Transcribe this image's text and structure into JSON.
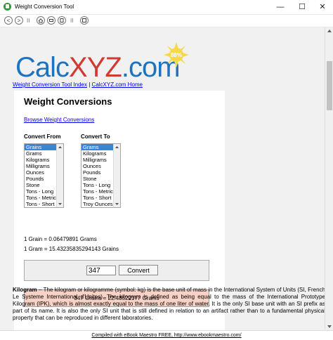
{
  "window": {
    "title": "Weight Conversion Tool",
    "minimize": "—",
    "maximize": "☐",
    "close": "✕"
  },
  "toolbar": {
    "back": "<",
    "forward": ">",
    "pause": "II",
    "separator": "II"
  },
  "page": {
    "logo_calc": "Calc",
    "logo_xyz": "XYZ",
    "logo_com": ".com",
    "badge": "88%",
    "link_index": "Weight Conversion Tool Index",
    "link_separator": "|",
    "link_home": "CalcXYZ.com Home",
    "title": "Weight Conversions",
    "browse_link": "Browse Weight Conversions",
    "convert_from_label": "Convert From",
    "convert_to_label": "Convert To",
    "from_items": [
      "Grains",
      "Grams",
      "Kilograms",
      "Milligrams",
      "Ounces",
      "Pounds",
      "Stone",
      "Tons - Long",
      "Tons - Metric",
      "Tons - Short"
    ],
    "to_items": [
      "Grams",
      "Kilograms",
      "Milligrams",
      "Ounces",
      "Pounds",
      "Stone",
      "Tons - Long",
      "Tons - Metric",
      "Tons - Short",
      "Troy Ounces"
    ],
    "ratio1": "1 Grain = 0.06479891 Grams",
    "ratio2": "1 Gram = 15.43235835294143 Grains",
    "quantity": "347",
    "convert_button": "Convert",
    "result": "347 Grains = 22.48522177 Grams",
    "desc_term": "Kilogram",
    "desc_text": " – The kilogram or kilogramme (symbol: kg) is the base unit of mass in the International System of Units (SI, French Le Systeme International d'Unites). The kilogram is defined as being equal to the mass of the International Prototype Kilogram (IPK), which is almost exactly equal to the mass of one liter of water. It is the only SI base unit with an SI prefix as part of its name. It is also the only SI unit that is still defined in relation to an artifact rather than to a fundamental physical property that can be reproduced in different laboratories."
  },
  "footer": {
    "text": "Compiled with eBook Maestro FREE, http://www.ebookmaestro.com/"
  },
  "colors": {
    "logo_blue": "#1e73be",
    "logo_red": "#d03a35",
    "result_bg": "#f9d2c6",
    "selection": "#3b84d6"
  }
}
